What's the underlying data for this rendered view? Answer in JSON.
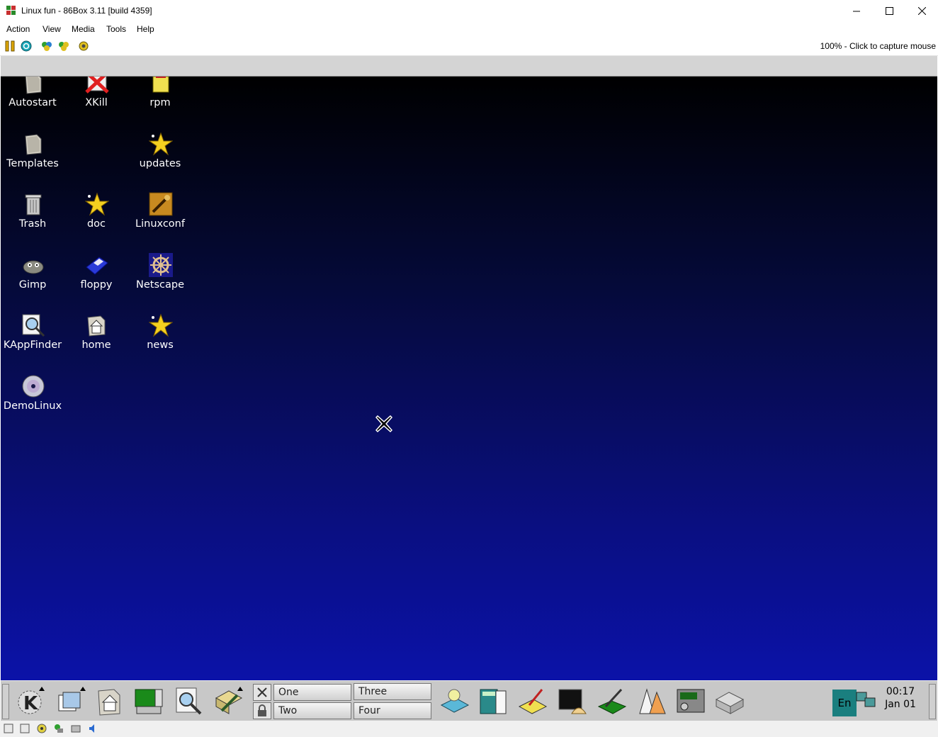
{
  "window": {
    "title": "Linux fun - 86Box 3.11 [build 4359]",
    "controls": [
      "minimize-icon",
      "maximize-icon",
      "close-icon"
    ]
  },
  "menu": [
    "Action",
    "View",
    "Media",
    "Tools",
    "Help"
  ],
  "toolbar": {
    "icons": [
      "pause-icon",
      "reset-icon",
      "ctrl-alt-del-icon",
      "ctrl-alt-esc-icon",
      "settings-icon"
    ],
    "capture_text": "100% - Click to capture mouse"
  },
  "desktop": {
    "icons": [
      {
        "label": "Autostart",
        "icon": "folder-icon"
      },
      {
        "label": "XKill",
        "icon": "xkill-icon"
      },
      {
        "label": "rpm",
        "icon": "rpm-package-icon"
      },
      {
        "label": "Templates",
        "icon": "folder-icon"
      },
      {
        "label": "updates",
        "icon": "star-link-icon"
      },
      {
        "label": "Trash",
        "icon": "trash-icon"
      },
      {
        "label": "doc",
        "icon": "star-link-icon"
      },
      {
        "label": "Linuxconf",
        "icon": "linuxconf-icon"
      },
      {
        "label": "Gimp",
        "icon": "gimp-icon"
      },
      {
        "label": "floppy",
        "icon": "floppy-icon"
      },
      {
        "label": "Netscape",
        "icon": "netscape-wheel-icon"
      },
      {
        "label": "KAppFinder",
        "icon": "kappfinder-icon"
      },
      {
        "label": "home",
        "icon": "home-folder-icon"
      },
      {
        "label": "news",
        "icon": "star-link-icon"
      },
      {
        "label": "DemoLinux",
        "icon": "cdrom-icon"
      }
    ]
  },
  "panel": {
    "pager": [
      "One",
      "Two",
      "Three",
      "Four"
    ],
    "layout_indicator": "En",
    "clock_time": "00:17",
    "clock_date": "Jan 01"
  },
  "colors": {
    "desktop_top": "#000000",
    "desktop_bottom": "#0b12a8",
    "panel_bg": "#c8c8c8",
    "en_bg": "#1a7f7f"
  }
}
